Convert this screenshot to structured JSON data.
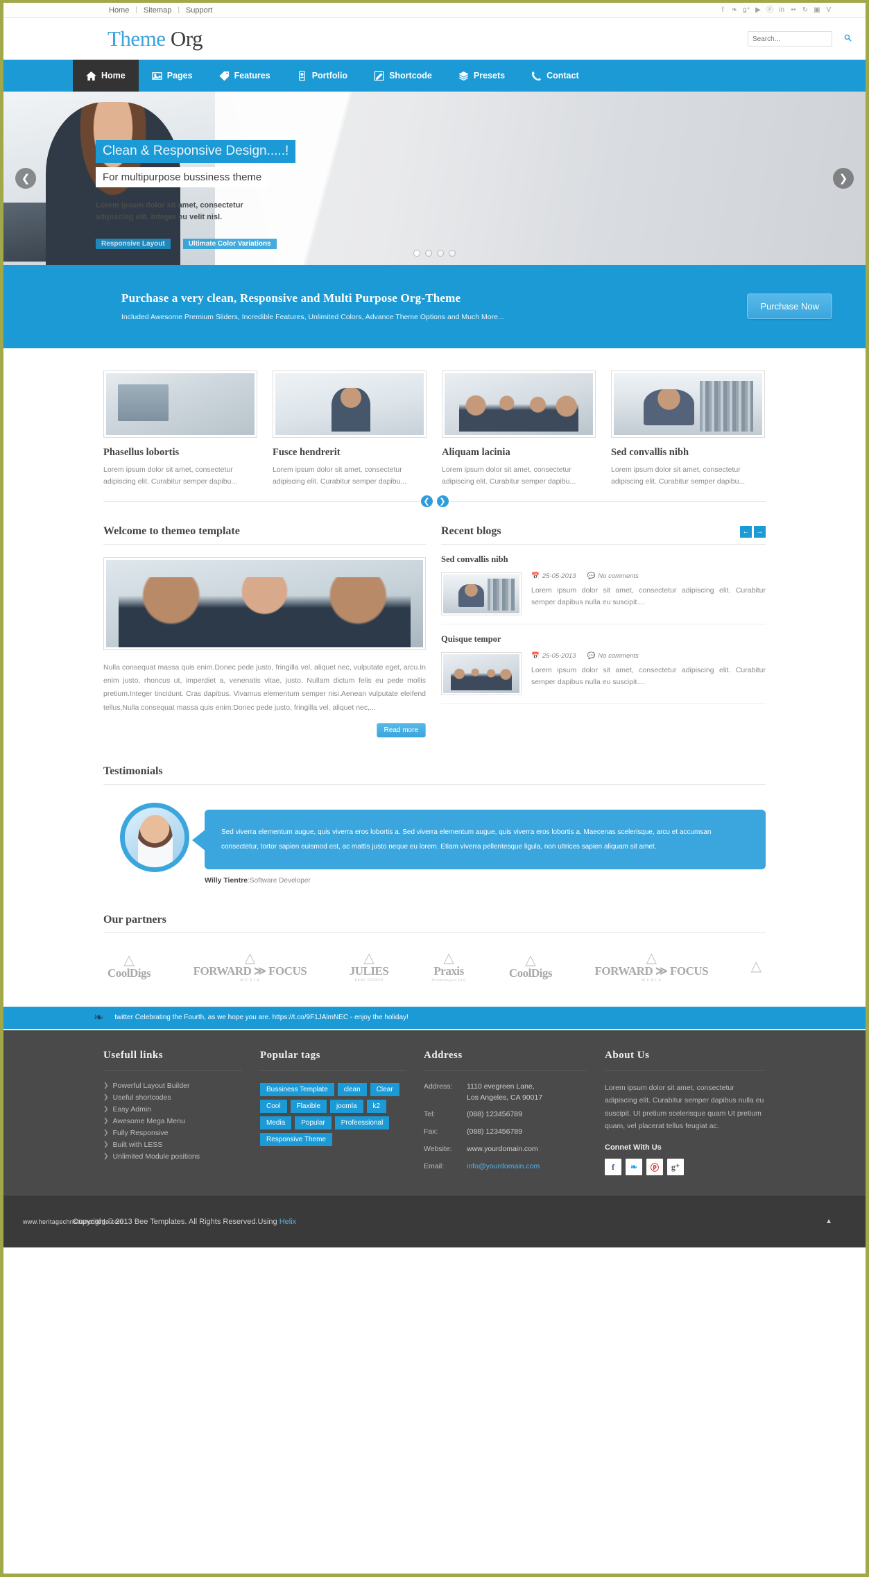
{
  "topbar": {
    "links": [
      "Home",
      "Sitemap",
      "Support"
    ],
    "separator": "|",
    "social_icons": [
      "facebook-icon",
      "twitter-icon",
      "googleplus-icon",
      "youtube-icon",
      "pinterest-icon",
      "linkedin-icon",
      "flickr-icon",
      "rss-icon",
      "instagram-icon",
      "vimeo-icon"
    ],
    "social_glyphs": [
      "f",
      "❧",
      "g⁺",
      "▶",
      "ⓟ",
      "in",
      "••",
      "↻",
      "▣",
      "V"
    ]
  },
  "header": {
    "logo_first": "Theme",
    "logo_second": "Org",
    "search_placeholder": "Search...",
    "search_value": ""
  },
  "mainnav": {
    "items": [
      {
        "label": "Home",
        "icon": "home-icon",
        "active": true
      },
      {
        "label": "Pages",
        "icon": "image-icon",
        "active": false
      },
      {
        "label": "Features",
        "icon": "tag-icon",
        "active": false
      },
      {
        "label": "Portfolio",
        "icon": "mobile-icon",
        "active": false
      },
      {
        "label": "Shortcode",
        "icon": "pencil-square-icon",
        "active": false
      },
      {
        "label": "Presets",
        "icon": "layers-icon",
        "active": false
      },
      {
        "label": "Contact",
        "icon": "phone-icon",
        "active": false
      }
    ]
  },
  "slider": {
    "title": "Clean & Responsive Design.....!",
    "subtitle": "For multipurpose bussiness theme",
    "text": "Lorem ipsum dolor sit amet, consectetur adipiscing elit. Integer eu velit nisl.",
    "tags": [
      "Responsive Layout",
      "Ultimate Color Variations"
    ],
    "prev_icon": "chevron-left-icon",
    "next_icon": "chevron-right-icon",
    "dots": 4,
    "active_dot": 0
  },
  "promo": {
    "title": "Purchase a very clean, Responsive and Multi Purpose Org-Theme",
    "subtitle": "Included Awesome Premium Sliders, Incredible Features, Unlimited Colors, Advance Theme Options and Much More...",
    "button": "Purchase Now"
  },
  "featured": {
    "cards": [
      {
        "title": "Phasellus lobortis",
        "text": "Lorem ipsum dolor sit amet, consectetur adipiscing elit. Curabitur semper dapibu...",
        "thumb": "ph-office"
      },
      {
        "title": "Fusce hendrerit",
        "text": "Lorem ipsum dolor sit amet, consectetur adipiscing elit. Curabitur semper dapibu...",
        "thumb": "ph-man"
      },
      {
        "title": "Aliquam lacinia",
        "text": "Lorem ipsum dolor sit amet, consectetur adipiscing elit. Curabitur semper dapibu...",
        "thumb": "ph-group"
      },
      {
        "title": "Sed convallis nibh",
        "text": "Lorem ipsum dolor sit amet, consectetur adipiscing elit. Curabitur semper dapibu...",
        "thumb": "ph-desk"
      }
    ],
    "prev_icon": "chevron-left-icon",
    "next_icon": "chevron-right-icon"
  },
  "welcome": {
    "heading": "Welcome to themeo template",
    "paragraph": "Nulla consequat massa quis enim.Donec pede justo, fringilla vel, aliquet nec, vulputate eget, arcu.In enim justo, rhoncus ut, imperdiet a, venenatis vitae, justo. Nullam dictum felis eu pede mollis pretium.Integer tincidunt. Cras dapibus. Vivamus elementum semper nisi.Aenean vulputate eleifend tellus.Nulla consequat massa quis enim:Donec pede justo, fringilla vel, aliquet nec,...",
    "read_more": "Read more"
  },
  "blogs": {
    "heading": "Recent blogs",
    "prev_icon": "arrow-left-icon",
    "next_icon": "arrow-right-icon",
    "items": [
      {
        "title": "Sed convallis nibh",
        "date": "25-05-2013",
        "comments": "No comments",
        "text": "Lorem ipsum dolor sit amet, consectetur adipiscing elit. Curabitur semper dapibus nulla eu suscipit....",
        "thumb": "ph-desk"
      },
      {
        "title": "Quisque tempor",
        "date": "25-05-2013",
        "comments": "No comments",
        "text": "Lorem ipsum dolor sit amet, consectetur adipiscing elit. Curabitur semper dapibus nulla eu suscipit....",
        "thumb": "ph-group"
      }
    ]
  },
  "testimonials": {
    "heading": "Testimonials",
    "quote": "Sed viverra elementum augue, quis viverra eros lobortis a. Sed viverra elementum augue, quis viverra eros lobortis a. Maecenas scelerisque, arcu et accumsan consectetur, tortor sapien euismod est, ac mattis justo neque eu lorem. Etiam viverra pellentesque ligula, non ultrices sapien aliquam sit amet.",
    "author": "Willy Tientre",
    "role": ":Software Developer"
  },
  "partners": {
    "heading": "Our partners",
    "logos": [
      {
        "name": "CoolDigs",
        "sub": "",
        "icon": "house-logo"
      },
      {
        "name": "FORWARD ≫ FOCUS",
        "sub": "M E D I A",
        "icon": "arc-logo"
      },
      {
        "name": "JULIES",
        "sub": "REAL ESTATE",
        "icon": "gem-logo"
      },
      {
        "name": "Praxis",
        "sub": "Technologies LLC",
        "icon": "cube-logo"
      },
      {
        "name": "CoolDigs",
        "sub": "",
        "icon": "house-logo"
      },
      {
        "name": "FORWARD ≫ FOCUS",
        "sub": "M E D I A",
        "icon": "arc-logo"
      },
      {
        "name": "",
        "sub": "",
        "icon": "gem-logo"
      }
    ]
  },
  "twitterbar": {
    "icon": "twitter-bird-icon",
    "text": "twitter Celebrating the Fourth, as we hope you are. https://t.co/9F1JAlmNEC - enjoy the holiday!"
  },
  "footer": {
    "useful": {
      "heading": "Usefull links",
      "items": [
        "Powerful Layout Builder",
        "Useful shortcodes",
        "Easy Admin",
        "Awesome Mega Menu",
        "Fully Responsive",
        "Built with LESS",
        "Unlimited Module positions"
      ]
    },
    "tags": {
      "heading": "Popular tags",
      "items": [
        "Bussiness Template",
        "clean",
        "Clear",
        "Cool",
        "Flaxible",
        "joomla",
        "k2",
        "Media",
        "Popular",
        "Profeessional",
        "Responsive Theme"
      ]
    },
    "address": {
      "heading": "Address",
      "rows": [
        {
          "key": "Address:",
          "value": "1110 evegreen Lane,\nLos Angeles, CA 90017",
          "link": false
        },
        {
          "key": "Tel:",
          "value": "(088) 123456789",
          "link": false
        },
        {
          "key": "Fax:",
          "value": "(088) 123456789",
          "link": false
        },
        {
          "key": "Website:",
          "value": "www.yourdomain.com",
          "link": false
        },
        {
          "key": "Email:",
          "value": "info@yourdomain.com",
          "link": true
        }
      ]
    },
    "about": {
      "heading": "About Us",
      "text": "Lorem ipsum dolor sit amet, consectetur adipiscing elit. Curabitur semper dapibus nulla eu suscipit. Ut pretium scelerisque quam Ut pretium quam, vel placerat tellus feugiat ac.",
      "connect_heading": "Connet With Us",
      "socials": [
        {
          "name": "facebook-icon",
          "glyph": "f"
        },
        {
          "name": "twitter-icon",
          "glyph": "❧"
        },
        {
          "name": "pinterest-icon",
          "glyph": "ⓟ"
        },
        {
          "name": "googleplus-icon",
          "glyph": "g⁺"
        }
      ]
    }
  },
  "copyright": {
    "text": "Copyright © 2013 Bee Templates. All Rights Reserved.Using ",
    "link": "Helix",
    "watermark": "www.heritagechristiancollege.com",
    "to_top_icon": "caret-up-icon"
  },
  "colors": {
    "accent": "#1b9ad6",
    "dark": "#333333",
    "footer_bg": "#4a4a4a",
    "border": "#a0a84a"
  }
}
